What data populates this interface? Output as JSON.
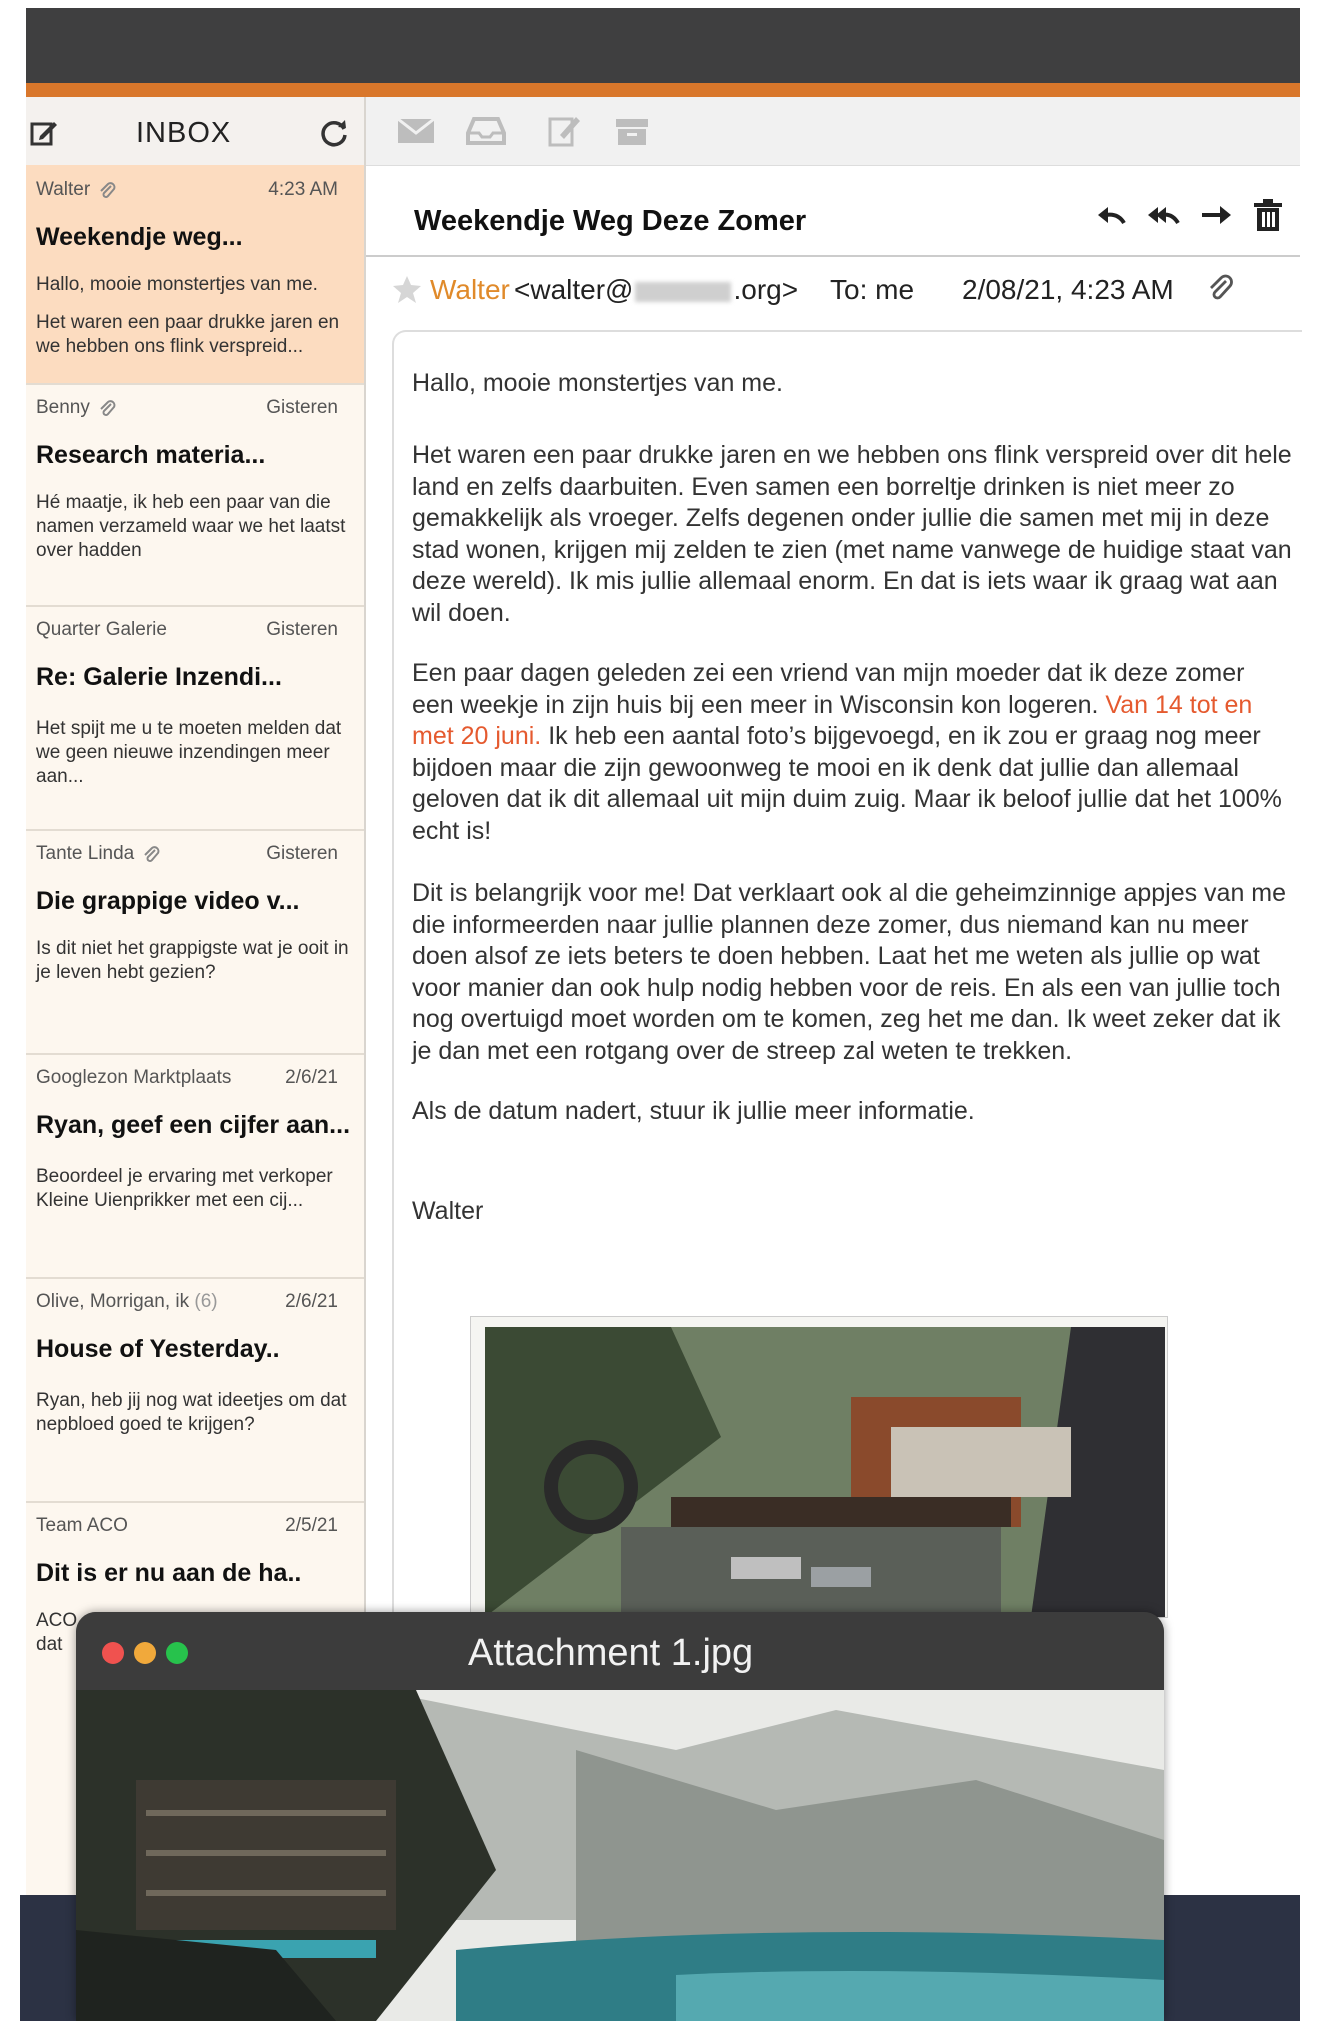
{
  "sidebar": {
    "title": "INBOX",
    "messages": [
      {
        "sender": "Walter",
        "time": "4:23 AM",
        "subject": "Weekendje weg...",
        "preview": "Hallo, mooie monstertjes van me.",
        "preview2": "Het waren een paar drukke jaren en we hebben ons flink verspreid...",
        "has_attachment": true
      },
      {
        "sender": "Benny",
        "time": "Gisteren",
        "subject": "Research materia...",
        "preview": "Hé maatje, ik heb een paar van die namen verzameld waar we het laatst over hadden",
        "has_attachment": true
      },
      {
        "sender": "Quarter Galerie",
        "time": "Gisteren",
        "subject": "Re: Galerie Inzendi...",
        "preview": "Het spijt me u te moeten melden dat we geen nieuwe inzendingen meer aan...",
        "has_attachment": false
      },
      {
        "sender": "Tante Linda",
        "time": "Gisteren",
        "subject": "Die grappige video v...",
        "preview": "Is dit niet het grappigste wat je ooit in je leven hebt gezien?",
        "has_attachment": true
      },
      {
        "sender": "Googlezon",
        "sender2": "Marktplaats",
        "time": "2/6/21",
        "subject": "Ryan, geef een cijfer aan...",
        "preview": "Beoordeel je ervaring met verkoper Kleine Uienprikker met een cij...",
        "has_attachment": false
      },
      {
        "sender": "Olive, Morrigan, ik",
        "count": "(6)",
        "time": "2/6/21",
        "subject": "House of Yesterday..",
        "preview": "Ryan, heb jij nog wat ideetjes om dat nepbloed goed te krijgen?",
        "has_attachment": false
      },
      {
        "sender": "Team ACO",
        "time": "2/5/21",
        "subject": "Dit is er nu aan de ha..",
        "preview": "ACO",
        "preview2": "dat",
        "has_attachment": false
      }
    ]
  },
  "reading": {
    "subject": "Weekendje Weg Deze Zomer",
    "from_name": "Walter",
    "from_email_start": "<walter@",
    "from_email_end": ".org>",
    "to": "To: me",
    "date": "2/08/21, 4:23 AM",
    "greeting": "Hallo, mooie monstertjes van me.",
    "p1": "Het waren een paar drukke jaren en we hebben ons flink verspreid over dit hele land en zelfs daarbuiten. Even samen een borreltje drinken is niet meer zo gemakkelijk als vroeger. Zelfs degenen onder jullie die samen met mij in deze stad wonen, krijgen mij zelden te zien (met name vanwege de huidige staat van deze wereld). Ik mis jullie allemaal enorm. En dat is iets waar ik graag wat aan wil doen.",
    "p2_a": "Een paar dagen geleden zei een vriend van mijn moeder dat ik deze zomer een weekje in zijn huis bij een meer in Wisconsin kon logeren. ",
    "p2_highlight": "Van 14 tot en met 20 juni.",
    "p2_b": " Ik heb een aantal foto’s bijgevoegd, en ik zou er graag nog meer bijdoen maar die zijn gewoonweg te mooi en ik denk dat jullie dan allemaal geloven dat ik dit allemaal uit mijn duim zuig. Maar ik beloof jullie dat het 100% echt is!",
    "p3": "Dit is belangrijk voor me! Dat verklaart ook al die geheimzinnige appjes van me die informeerden naar jullie plannen deze zomer, dus niemand kan nu meer doen alsof ze iets beters te doen hebben. Laat het me weten als jullie op wat voor manier dan ook hulp nodig hebben voor de reis. En als een van jullie toch nog overtuigd moet worden om te komen, zeg het me dan. Ik weet zeker dat ik je dan met een rotgang over de streep zal weten te trekken.",
    "p4": "Als de datum nadert, stuur ik jullie meer informatie.",
    "signature": "Walter"
  },
  "attachment_window": {
    "title": "Attachment 1.jpg"
  },
  "colors": {
    "accent": "#d9772b",
    "selected_row": "#fcdcc0",
    "sender_highlight": "#e08a2a",
    "date_highlight": "#e55a2f"
  },
  "icons": [
    "compose-icon",
    "refresh-icon",
    "mail-icon",
    "inbox-tray-icon",
    "edit-icon",
    "archive-icon",
    "reply-icon",
    "reply-all-icon",
    "forward-icon",
    "trash-icon",
    "star-icon",
    "paperclip-icon"
  ]
}
